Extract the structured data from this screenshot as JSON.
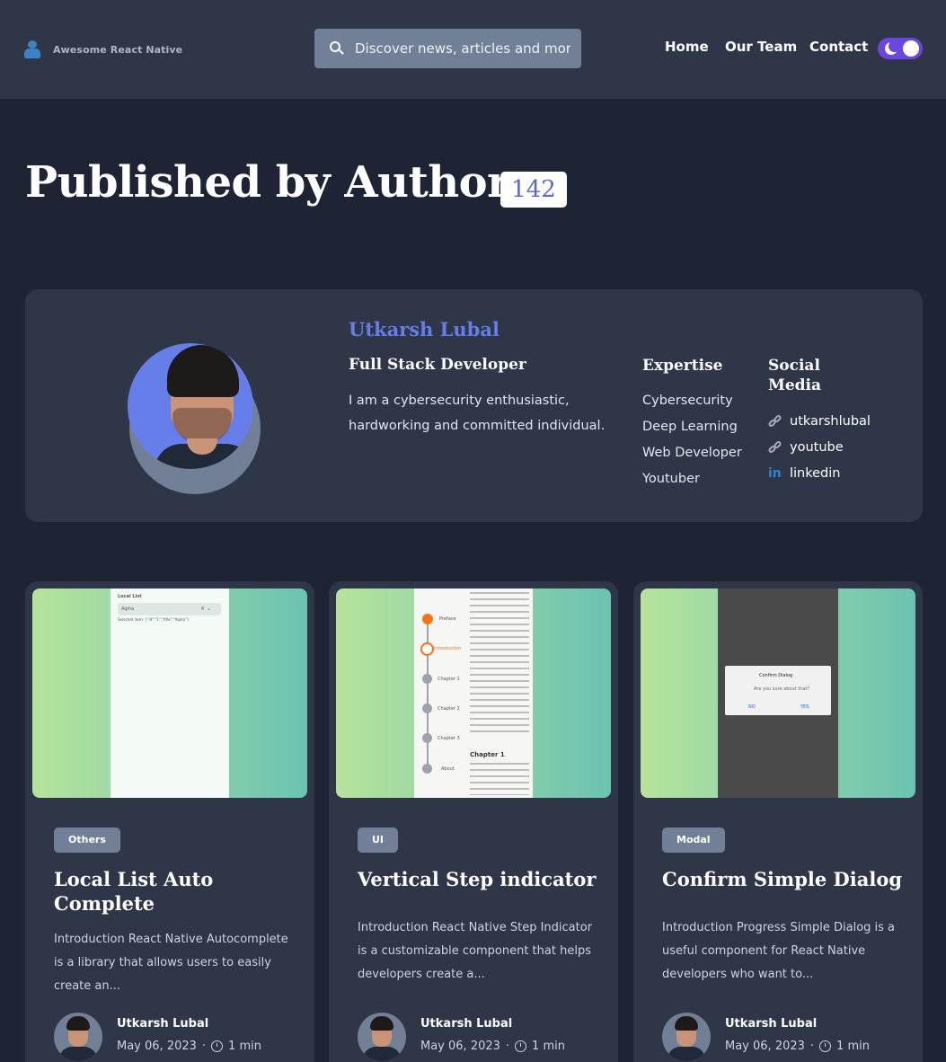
{
  "header": {
    "brand_name": "Awesome React Native",
    "search_placeholder": "Discover news, articles and more..",
    "nav": [
      "Home",
      "Our Team",
      "Contact"
    ],
    "theme_toggle": "dark"
  },
  "page": {
    "title": "Published by Author",
    "post_count": "142"
  },
  "author": {
    "name": "Utkarsh Lubal",
    "role": "Full Stack Developer",
    "bio": "I am a cybersecurity enthusiastic, hardworking and committed individual.",
    "expertise_heading": "Expertise",
    "expertise": [
      "Cybersecurity",
      "Deep Learning",
      "Web Developer",
      "Youtuber"
    ],
    "social_heading": "Social Media",
    "social": [
      {
        "label": "utkarshlubal",
        "icon": "link-icon"
      },
      {
        "label": "youtube",
        "icon": "link-icon"
      },
      {
        "label": "linkedin",
        "icon": "linkedin-icon"
      }
    ]
  },
  "posts": [
    {
      "tag": "Others",
      "title": "Local List Auto Complete",
      "excerpt": "Introduction React Native Autocomplete is a library that allows users to easily create an...",
      "author": "Utkarsh Lubal",
      "date": "May 06, 2023",
      "read_time": "1 min"
    },
    {
      "tag": "UI",
      "title": "Vertical Step indicator",
      "excerpt": "Introduction React Native Step Indicator is a customizable component that helps developers create a...",
      "author": "Utkarsh Lubal",
      "date": "May 06, 2023",
      "read_time": "1 min"
    },
    {
      "tag": "Modal",
      "title": "Confirm Simple Dialog",
      "excerpt": "Introduction Progress Simple Dialog is a useful component for React Native developers who want to...",
      "author": "Utkarsh Lubal",
      "date": "May 06, 2023",
      "read_time": "1 min"
    }
  ],
  "thumbnails": {
    "autocomplete": {
      "header": "Local List",
      "input": "Alpha",
      "selected": "Selected item: {\"id\":\"1\",\"title\":\"Alpha\"}"
    },
    "stepper": {
      "steps": [
        "Preface",
        "Introduction",
        "Chapter 1",
        "Chapter 2",
        "Chapter 3",
        "About"
      ],
      "content_title": "Chapter 1"
    },
    "dialog": {
      "title": "Confirm Dialog",
      "message": "Are you sure about that?",
      "no": "NO",
      "yes": "YES"
    }
  },
  "colors": {
    "accent": "#667eea",
    "toggle": "#6b46e0",
    "background": "#1e2433",
    "card": "#2e3648"
  }
}
